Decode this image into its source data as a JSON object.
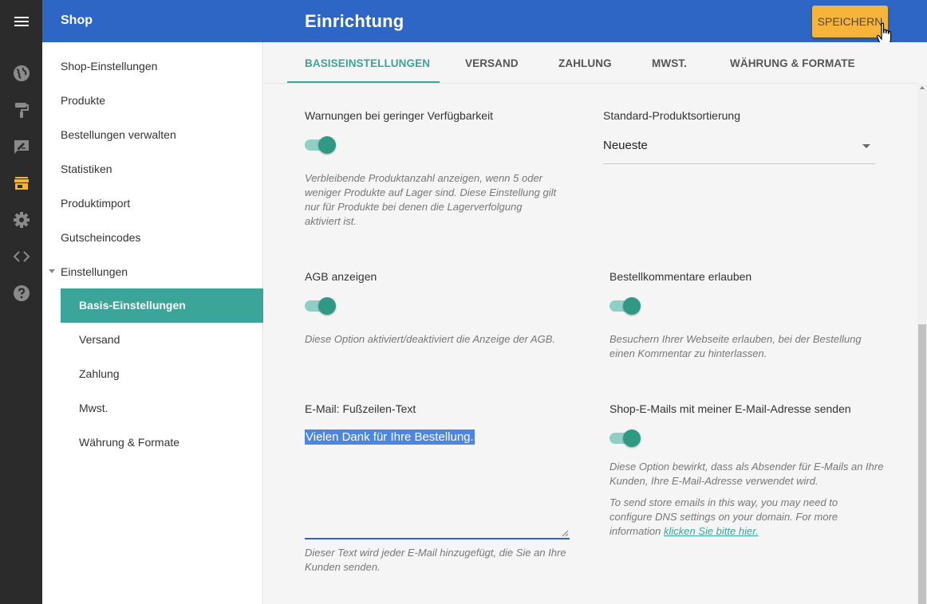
{
  "header": {
    "shop_title": "Shop",
    "page_title": "Einrichtung",
    "save_label": "SPEICHERN"
  },
  "rail_icons": [
    "globe-icon",
    "paint-roller-icon",
    "edit-icon",
    "store-icon",
    "settings-icon",
    "code-icon",
    "help-icon"
  ],
  "sidebar": {
    "items": [
      {
        "label": "Shop-Einstellungen"
      },
      {
        "label": "Produkte"
      },
      {
        "label": "Bestellungen verwalten"
      },
      {
        "label": "Statistiken"
      },
      {
        "label": "Produktimport"
      },
      {
        "label": "Gutscheincodes"
      },
      {
        "label": "Einstellungen"
      }
    ],
    "subitems": [
      {
        "label": "Basis-Einstellungen",
        "active": true
      },
      {
        "label": "Versand"
      },
      {
        "label": "Zahlung"
      },
      {
        "label": "Mwst."
      },
      {
        "label": "Währung & Formate"
      }
    ]
  },
  "tabs": [
    {
      "label": "BASISEINSTELLUNGEN",
      "active": true
    },
    {
      "label": "VERSAND"
    },
    {
      "label": "ZAHLUNG"
    },
    {
      "label": "MWST."
    },
    {
      "label": "WÄHRUNG & FORMATE"
    }
  ],
  "settings": {
    "low_stock": {
      "label": "Warnungen bei geringer Verfügbarkeit",
      "enabled": true,
      "description": "Verbleibende Produktanzahl anzeigen, wenn 5 oder weniger Produkte auf Lager sind. Diese Einstellung gilt nur für Produkte bei denen die Lagerverfolgung aktiviert ist."
    },
    "sorting": {
      "label": "Standard-Produktsortierung",
      "value": "Neueste"
    },
    "terms": {
      "label": "AGB anzeigen",
      "enabled": true,
      "description": "Diese Option aktiviert/deaktiviert die Anzeige der AGB."
    },
    "order_comments": {
      "label": "Bestellkommentare erlauben",
      "enabled": true,
      "description": "Besuchern Ihrer Webseite erlauben, bei der Bestellung einen Kommentar zu hinterlassen."
    },
    "email_footer": {
      "label": "E-Mail: Fußzeilen-Text",
      "value": "Vielen Dank für Ihre Bestellung.",
      "description": "Dieser Text wird jeder E-Mail hinzugefügt, die Sie an Ihre Kunden senden."
    },
    "own_email": {
      "label": "Shop-E-Mails mit meiner E-Mail-Adresse senden",
      "enabled": true,
      "description": "Diese Option bewirkt, dass als Absender für E-Mails an Ihre Kunden, Ihre E-Mail-Adresse verwendet wird.",
      "dns_note": "To send store emails in this way, you may need to configure DNS settings on your domain. For more information",
      "link_label": "klicken Sie bitte hier."
    }
  },
  "colors": {
    "header": "#2d66c5",
    "rail": "#2b2b2b",
    "accent": "#3aa598",
    "save_button": "#f6b53a",
    "active_rail_icon": "#f5b52e"
  }
}
